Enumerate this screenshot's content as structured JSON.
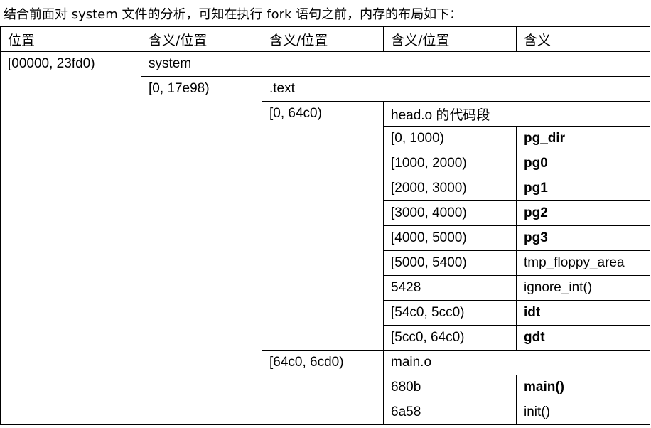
{
  "intro": "结合前面对 system 文件的分析，可知在执行 fork 语句之前，内存的布局如下：",
  "headers": [
    "位置",
    "含义/位置",
    "含义/位置",
    "含义/位置",
    "含义"
  ],
  "rows": {
    "r0": [
      "[00000, 23fd0)",
      "system"
    ],
    "r1": [
      "[0, 17e98)",
      ".text"
    ],
    "r2": [
      "[0, 64c0)",
      "head.o 的代码段"
    ],
    "r3": [
      "[0, 1000)",
      "pg_dir"
    ],
    "r4": [
      "[1000, 2000)",
      "pg0"
    ],
    "r5": [
      "[2000, 3000)",
      "pg1"
    ],
    "r6": [
      "[3000, 4000)",
      "pg2"
    ],
    "r7": [
      "[4000, 5000)",
      "pg3"
    ],
    "r8": [
      "[5000, 5400)",
      "tmp_floppy_area"
    ],
    "r9": [
      "5428",
      "ignore_int()"
    ],
    "r10": [
      "[54c0, 5cc0)",
      "idt"
    ],
    "r11": [
      "[5cc0, 64c0)",
      "gdt"
    ],
    "r12": [
      "[64c0, 6cd0)",
      "main.o"
    ],
    "r13": [
      "680b",
      "main()"
    ],
    "r14": [
      "6a58",
      "init()"
    ]
  }
}
